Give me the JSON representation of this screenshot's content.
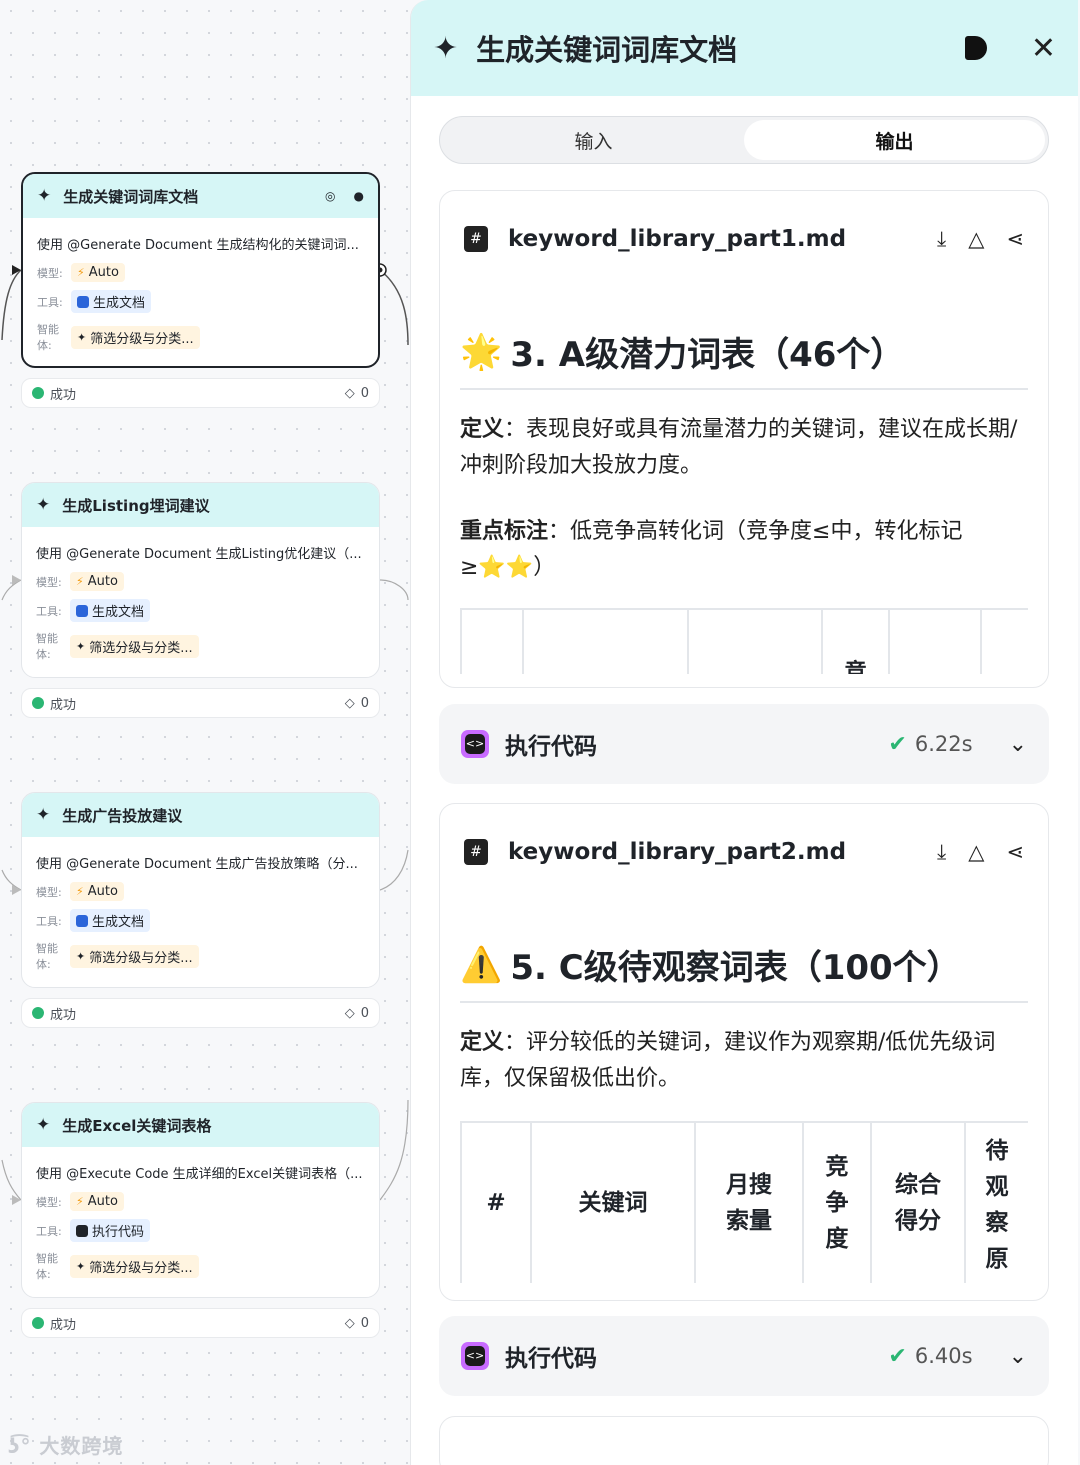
{
  "canvas": {
    "nodes": [
      {
        "title": "生成关键词词库文档",
        "desc": "使用 @Generate Document 生成结构化的关键词词...",
        "model_label": "模型:",
        "model": "Auto",
        "tool_label": "工具:",
        "tool": "生成文档",
        "agent_label": "智能体:",
        "agent": "筛选分级与分类...",
        "status": "成功",
        "count": "0"
      },
      {
        "title": "生成Listing埋词建议",
        "desc": "使用 @Generate Document 生成Listing优化建议（...",
        "model_label": "模型:",
        "model": "Auto",
        "tool_label": "工具:",
        "tool": "生成文档",
        "agent_label": "智能体:",
        "agent": "筛选分级与分类...",
        "status": "成功",
        "count": "0"
      },
      {
        "title": "生成广告投放建议",
        "desc": "使用 @Generate Document 生成广告投放策略（分...",
        "model_label": "模型:",
        "model": "Auto",
        "tool_label": "工具:",
        "tool": "生成文档",
        "agent_label": "智能体:",
        "agent": "筛选分级与分类...",
        "status": "成功",
        "count": "0"
      },
      {
        "title": "生成Excel关键词表格",
        "desc": "使用 @Execute Code 生成详细的Excel关键词表格（...",
        "model_label": "模型:",
        "model": "Auto",
        "tool_label": "工具:",
        "tool": "执行代码",
        "agent_label": "智能体:",
        "agent": "筛选分级与分类...",
        "status": "成功",
        "count": "0"
      }
    ],
    "watermark": "大数跨境"
  },
  "panel": {
    "title": "生成关键词词库文档",
    "tabs": {
      "input": "输入",
      "output": "输出"
    },
    "file1": {
      "name": "keyword_library_part1.md",
      "heading_icon": "🌟",
      "heading": "3. A级潜力词表（46个）",
      "def_label": "定义",
      "def_text": "：表现良好或具有流量潜力的关键词，建议在成长期/冲刺阶段加大投放力度。",
      "focus_label": "重点标注",
      "focus_text": "：低竞争高转化词（竞争度≤中，转化标记≥⭐⭐）",
      "table_partial_header": "竞"
    },
    "exec1": {
      "label": "执行代码",
      "time": "6.22s"
    },
    "file2": {
      "name": "keyword_library_part2.md",
      "heading_icon": "⚠️",
      "heading": "5. C级待观察词表（100个）",
      "def_label": "定义",
      "def_text": "：评分较低的关键词，建议作为观察期/低优先级词库，仅保留极低出价。",
      "table_headers": [
        "#",
        "关键词",
        "月搜索量",
        "竞争度",
        "综合得分",
        "待观察原因"
      ]
    },
    "exec2": {
      "label": "执行代码",
      "time": "6.40s"
    }
  }
}
